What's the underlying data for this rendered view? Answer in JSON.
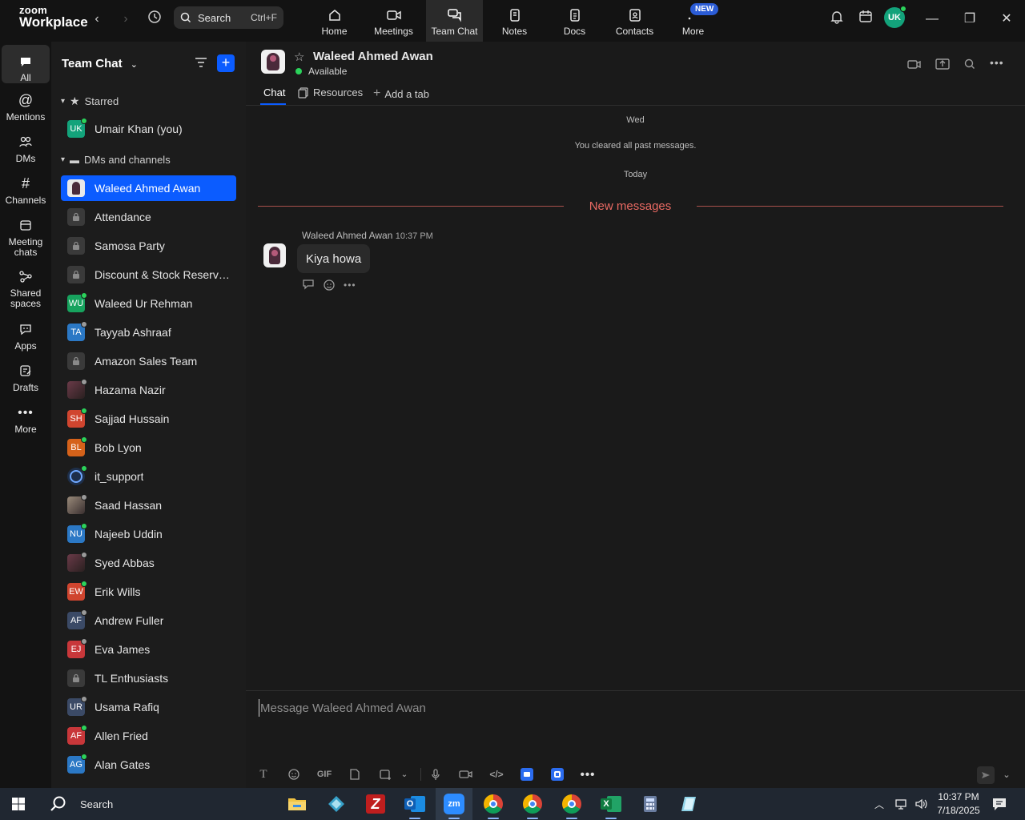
{
  "app": {
    "logo_top": "zoom",
    "logo_bottom": "Workplace"
  },
  "topbar": {
    "search": {
      "label": "Search",
      "shortcut": "Ctrl+F"
    },
    "nav": [
      {
        "label": "Home",
        "icon": "home-icon"
      },
      {
        "label": "Meetings",
        "icon": "video-camera-icon"
      },
      {
        "label": "Team Chat",
        "icon": "chat-bubbles-icon",
        "active": true
      },
      {
        "label": "Notes",
        "icon": "notes-icon"
      },
      {
        "label": "Docs",
        "icon": "docs-icon"
      },
      {
        "label": "Contacts",
        "icon": "contacts-icon"
      },
      {
        "label": "More",
        "icon": "more-dots-icon"
      }
    ],
    "new_badge": "NEW",
    "user_initials": "UK",
    "user_avatar_color": "#13a37b"
  },
  "rail": {
    "items": [
      {
        "label": "All",
        "icon": "chat-bubble-icon",
        "active": true
      },
      {
        "label": "Mentions",
        "icon": "at-sign-icon"
      },
      {
        "label": "DMs",
        "icon": "people-icon"
      },
      {
        "label": "Channels",
        "icon": "hash-icon"
      },
      {
        "label": "Meeting chats",
        "icon": "calendar-icon"
      },
      {
        "label": "Shared spaces",
        "icon": "shared-spaces-icon"
      },
      {
        "label": "Apps",
        "icon": "apps-icon"
      },
      {
        "label": "Drafts",
        "icon": "drafts-icon"
      },
      {
        "label": "More",
        "icon": "more-dots-icon"
      }
    ]
  },
  "sidebar": {
    "title": "Team Chat",
    "starred_label": "Starred",
    "starred": [
      {
        "label": "Umair Khan (you)",
        "initials": "UK",
        "color": "#13a37b",
        "status": "#2bd35b"
      }
    ],
    "dms_label": "DMs and channels",
    "items": [
      {
        "label": "Waleed Ahmed Awan",
        "type": "photo",
        "active": true
      },
      {
        "label": "Attendance",
        "type": "lock"
      },
      {
        "label": "Samosa Party",
        "type": "lock"
      },
      {
        "label": "Discount & Stock Reservati...",
        "type": "lock"
      },
      {
        "label": "Waleed Ur Rehman",
        "initials": "WU",
        "color": "#17a35e",
        "status": "#2bd35b"
      },
      {
        "label": "Tayyab Ashraaf",
        "initials": "TA",
        "color": "#2b78c5",
        "status": "#9a9a9a"
      },
      {
        "label": "Amazon Sales Team",
        "type": "lock"
      },
      {
        "label": "Hazama Nazir",
        "type": "photo-dark",
        "status": "#9a9a9a"
      },
      {
        "label": "Sajjad Hussain",
        "initials": "SH",
        "color": "#d0452f",
        "status": "#2bd35b"
      },
      {
        "label": "Bob Lyon",
        "initials": "BL",
        "color": "#d5621a",
        "status": "#2bd35b"
      },
      {
        "label": "it_support",
        "type": "logo",
        "status": "#2bd35b"
      },
      {
        "label": "Saad Hassan",
        "type": "photo",
        "status": "#9a9a9a"
      },
      {
        "label": "Najeeb Uddin",
        "initials": "NU",
        "color": "#2b78c5",
        "status": "#2bd35b"
      },
      {
        "label": "Syed Abbas",
        "type": "photo-dark",
        "status": "#9a9a9a"
      },
      {
        "label": "Erik Wills",
        "initials": "EW",
        "color": "#d0452f",
        "status": "#2bd35b"
      },
      {
        "label": "Andrew Fuller",
        "initials": "AF",
        "color": "#3b4a66",
        "status": "#9a9a9a"
      },
      {
        "label": "Eva James",
        "initials": "EJ",
        "color": "#c8373a",
        "status": "#9a9a9a"
      },
      {
        "label": "TL Enthusiasts",
        "type": "lock"
      },
      {
        "label": "Usama Rafiq",
        "initials": "UR",
        "color": "#3b4a66",
        "status": "#9a9a9a"
      },
      {
        "label": "Allen Fried",
        "initials": "AF",
        "color": "#c8373a",
        "status": "#2bd35b"
      },
      {
        "label": "Alan Gates",
        "initials": "AG",
        "color": "#2b78c5",
        "status": "#2bd35b"
      }
    ]
  },
  "chat": {
    "contact_name": "Waleed Ahmed Awan",
    "contact_status": "Available",
    "tabs": [
      {
        "label": "Chat",
        "active": true
      },
      {
        "label": "Resources",
        "icon": "resources-icon"
      },
      {
        "label": "Add a tab",
        "icon": "plus-icon"
      }
    ],
    "day1": "Wed",
    "cleared_notice": "You cleared all past messages.",
    "day2": "Today",
    "new_messages_label": "New messages",
    "message": {
      "sender": "Waleed Ahmed Awan",
      "time": "10:37 PM",
      "text": "Kiya howa"
    },
    "composer_placeholder": "Message Waleed Ahmed Awan",
    "gif_label": "GIF"
  },
  "taskbar": {
    "search_label": "Search",
    "time": "10:37 PM",
    "date": "7/18/2025"
  }
}
